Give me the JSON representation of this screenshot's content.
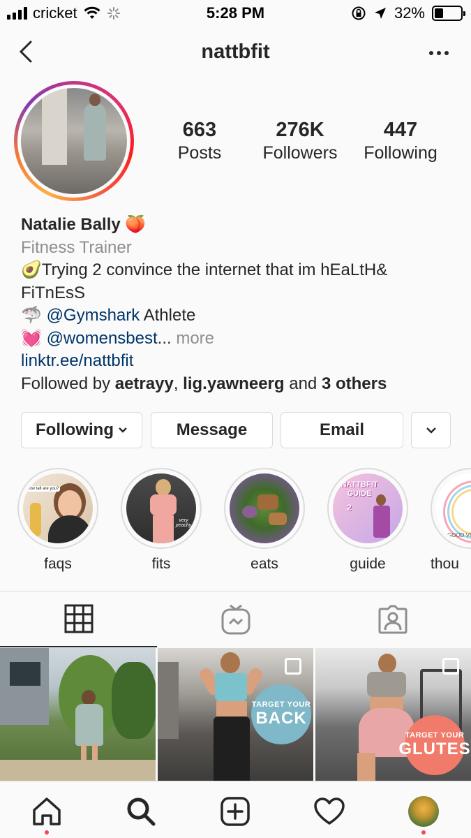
{
  "status_bar": {
    "carrier": "cricket",
    "time": "5:28 PM",
    "battery": "32%",
    "battery_level": 0.32
  },
  "header": {
    "username": "nattbfit",
    "back_icon": "chevron-left-icon",
    "more_icon": "more-horizontal-icon"
  },
  "stats": [
    {
      "value": "663",
      "label": "Posts"
    },
    {
      "value": "276K",
      "label": "Followers"
    },
    {
      "value": "447",
      "label": "Following"
    }
  ],
  "bio": {
    "name": "Natalie Bally",
    "name_emoji": "🍑",
    "category": "Fitness Trainer",
    "line1_emoji": "🥑",
    "line1_a": "Trying 2 convince the internet that im hEaLtH&",
    "line1_b": "FiTnEsS",
    "line2_emoji": "🦈",
    "line2_mention": "@Gymshark",
    "line2_text": " Athlete",
    "line3_emoji": "💓",
    "line3_mention": "@womensbest",
    "line3_ellipsis": "...",
    "line3_more": " more",
    "link": "linktr.ee/nattbfit",
    "followed_prefix": "Followed by ",
    "followed_user1": "aetrayy",
    "followed_sep": ", ",
    "followed_user2": "lig.yawneerg",
    "followed_and": " and ",
    "followed_others": "3 others"
  },
  "actions": {
    "following": "Following",
    "message": "Message",
    "email": "Email"
  },
  "highlights": [
    {
      "label": "faqs",
      "art": "how tall are you?"
    },
    {
      "label": "fits",
      "art": "very peachy"
    },
    {
      "label": "eats"
    },
    {
      "label": "guide",
      "art_title": "NATTBFIT GUIDE",
      "art_number": "2"
    },
    {
      "label": "thou",
      "art": "GOOD VIB"
    }
  ],
  "tabs": [
    {
      "name": "grid",
      "icon": "grid-icon",
      "active": true
    },
    {
      "name": "igtv",
      "icon": "igtv-icon",
      "active": false
    },
    {
      "name": "tagged",
      "icon": "tagged-person-icon",
      "active": false
    }
  ],
  "posts": [
    {
      "type": "photo"
    },
    {
      "type": "carousel",
      "badge_small": "TARGET YOUR",
      "badge_big": "BACK",
      "badge_color": "#7fb8c8"
    },
    {
      "type": "carousel",
      "badge_small": "TARGET YOUR",
      "badge_big": "GLUTES",
      "badge_color": "#f07b6a"
    }
  ],
  "nav": [
    {
      "name": "home",
      "icon": "home-icon",
      "dot": true
    },
    {
      "name": "search",
      "icon": "search-icon",
      "dot": false
    },
    {
      "name": "new-post",
      "icon": "plus-square-icon",
      "dot": false
    },
    {
      "name": "activity",
      "icon": "heart-icon",
      "dot": false
    },
    {
      "name": "profile",
      "icon": "profile-avatar-icon",
      "dot": true
    }
  ],
  "colors": {
    "link": "#003569",
    "muted": "#8e8e8e",
    "notification": "#ed4956"
  }
}
